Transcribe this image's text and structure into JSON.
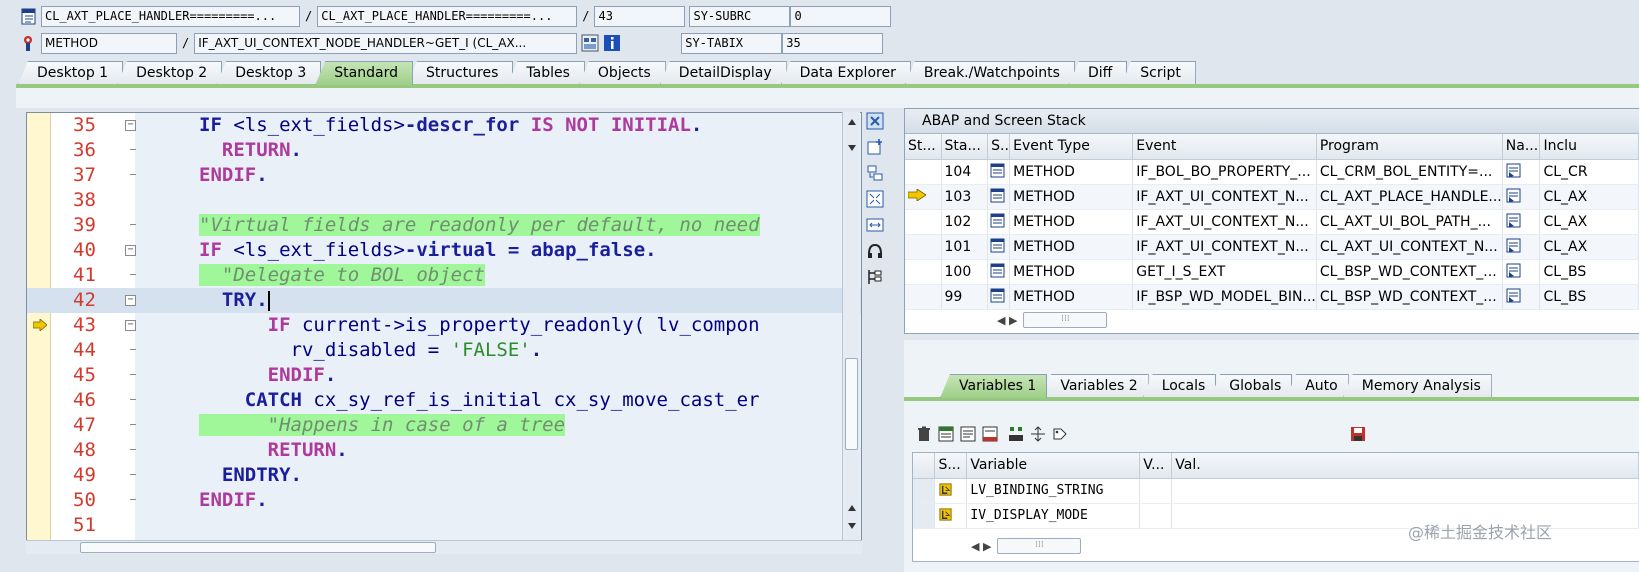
{
  "header": {
    "row1": {
      "program": "CL_AXT_PLACE_HANDLER=========...",
      "include": "CL_AXT_PLACE_HANDLER=========...",
      "line": "43",
      "sysvar_name": "SY-SUBRC",
      "sysvar_value": "0"
    },
    "row2": {
      "event_type": "METHOD",
      "event_name": "IF_AXT_UI_CONTEXT_NODE_HANDLER~GET_I (CL_AX...",
      "sysvar_name": "SY-TABIX",
      "sysvar_value": "35"
    },
    "sep": "/"
  },
  "tabs": [
    "Desktop 1",
    "Desktop 2",
    "Desktop 3",
    "Standard",
    "Structures",
    "Tables",
    "Objects",
    "DetailDisplay",
    "Data Explorer",
    "Break./Watchpoints",
    "Diff",
    "Script"
  ],
  "active_tab": "Standard",
  "editor": {
    "current_line": 43,
    "lines": [
      {
        "n": "35",
        "tokens": [
          [
            "kw",
            "IF "
          ],
          [
            "pl",
            "<ls_ext_fields>"
          ],
          [
            "kw",
            "-descr_for "
          ],
          [
            "pu",
            "IS NOT INITIAL"
          ],
          [
            "kw",
            "."
          ]
        ]
      },
      {
        "n": "36",
        "tokens": [
          [
            "pu",
            "  RETURN"
          ],
          [
            "kw",
            "."
          ]
        ]
      },
      {
        "n": "37",
        "tokens": [
          [
            "pu",
            "ENDIF"
          ],
          [
            "kw",
            "."
          ]
        ]
      },
      {
        "n": "38",
        "tokens": []
      },
      {
        "n": "39",
        "tokens": [
          [
            "cm",
            "\"Virtual fields are readonly per default, no need"
          ]
        ]
      },
      {
        "n": "40",
        "tokens": [
          [
            "pu",
            "IF "
          ],
          [
            "pl",
            "<ls_ext_fields>"
          ],
          [
            "kw",
            "-virtual = abap_false."
          ]
        ]
      },
      {
        "n": "41",
        "tokens": [
          [
            "cm",
            "  \"Delegate to BOL object"
          ]
        ]
      },
      {
        "n": "42",
        "tokens": [
          [
            "kw",
            "  TRY."
          ]
        ]
      },
      {
        "n": "43",
        "tokens": [
          [
            "pu",
            "      IF "
          ],
          [
            "pl",
            "current->is_property_readonly( lv_compon"
          ]
        ]
      },
      {
        "n": "44",
        "tokens": [
          [
            "pl",
            "        rv_disabled = "
          ],
          [
            "st",
            "'FALSE'"
          ],
          [
            "kw",
            "."
          ]
        ]
      },
      {
        "n": "45",
        "tokens": [
          [
            "pu",
            "      ENDIF"
          ],
          [
            "kw",
            "."
          ]
        ]
      },
      {
        "n": "46",
        "tokens": [
          [
            "kw",
            "    CATCH "
          ],
          [
            "pl",
            "cx_sy_ref_is_initial cx_sy_move_cast_er"
          ]
        ]
      },
      {
        "n": "47",
        "tokens": [
          [
            "cm",
            "      \"Happens in case of a tree"
          ]
        ]
      },
      {
        "n": "48",
        "tokens": [
          [
            "pu",
            "      RETURN"
          ],
          [
            "kw",
            "."
          ]
        ]
      },
      {
        "n": "49",
        "tokens": [
          [
            "kw",
            "  ENDTRY."
          ]
        ]
      },
      {
        "n": "50",
        "tokens": [
          [
            "pu",
            "ENDIF"
          ],
          [
            "kw",
            "."
          ]
        ]
      },
      {
        "n": "51",
        "tokens": []
      }
    ]
  },
  "stack": {
    "title": "ABAP and Screen Stack",
    "columns": [
      "St...",
      "Sta...",
      "S..",
      "Event Type",
      "Event",
      "Program",
      "Na...",
      "Inclu"
    ],
    "rows": [
      {
        "level": "104",
        "type": "METHOD",
        "event": "IF_BOL_BO_PROPERTY_...",
        "program": "CL_CRM_BOL_ENTITY=...",
        "include": "CL_CR"
      },
      {
        "level": "103",
        "type": "METHOD",
        "event": "IF_AXT_UI_CONTEXT_N...",
        "program": "CL_AXT_PLACE_HANDLE...",
        "include": "CL_AX",
        "current": true
      },
      {
        "level": "102",
        "type": "METHOD",
        "event": "IF_AXT_UI_CONTEXT_N...",
        "program": "CL_AXT_UI_BOL_PATH_...",
        "include": "CL_AX"
      },
      {
        "level": "101",
        "type": "METHOD",
        "event": "IF_AXT_UI_CONTEXT_N...",
        "program": "CL_AXT_UI_CONTEXT_N...",
        "include": "CL_AX"
      },
      {
        "level": "100",
        "type": "METHOD",
        "event": "GET_I_S_EXT",
        "program": "CL_BSP_WD_CONTEXT_...",
        "include": "CL_BS"
      },
      {
        "level": "99",
        "type": "METHOD",
        "event": "IF_BSP_WD_MODEL_BIN...",
        "program": "CL_BSP_WD_CONTEXT_...",
        "include": "CL_BS"
      }
    ]
  },
  "variables": {
    "tabs": [
      "Variables 1",
      "Variables 2",
      "Locals",
      "Globals",
      "Auto",
      "Memory Analysis"
    ],
    "active_tab": "Variables 1",
    "columns": [
      "S...",
      "Variable",
      "V...",
      "Val."
    ],
    "rows": [
      {
        "name": "LV_BINDING_STRING",
        "value": ""
      },
      {
        "name": "IV_DISPLAY_MODE",
        "value": ""
      }
    ]
  },
  "watermark": "@稀土掘金技术社区",
  "colors": {
    "active_tab": "#9ecf88",
    "line_number": "#d33a2c",
    "keyword": "#1b1e9a",
    "comment_bg": "#9ff79a"
  }
}
